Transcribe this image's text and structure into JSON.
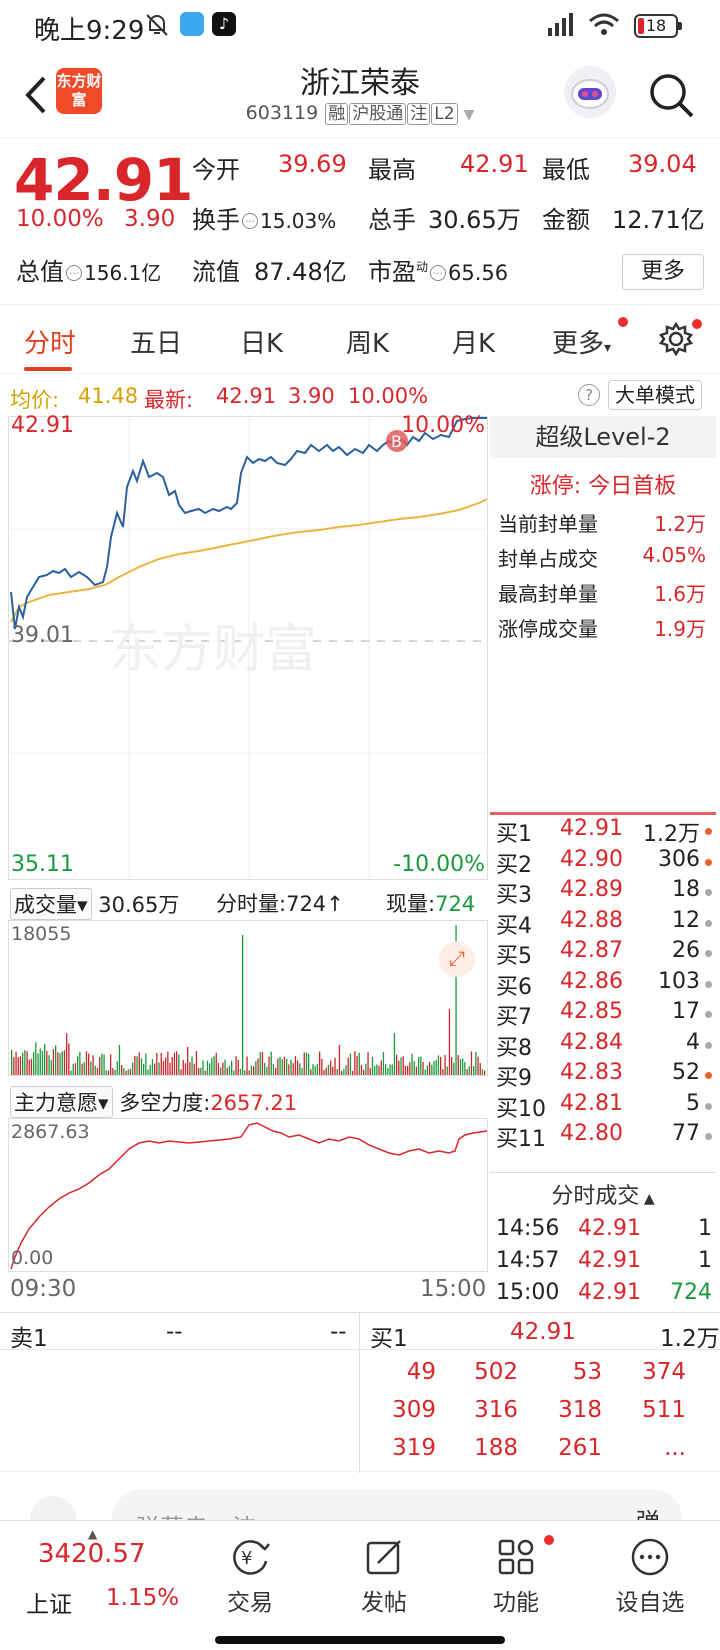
{
  "status": {
    "time": "晚上9:29",
    "battery": "18"
  },
  "header": {
    "logo_text": "东方财富",
    "stock_name": "浙江荣泰",
    "stock_code": "603119",
    "tags": [
      "融",
      "沪股通",
      "注",
      "L2"
    ]
  },
  "quote": {
    "price": "42.91",
    "change_pct": "10.00%",
    "change": "3.90",
    "open_label": "今开",
    "open": "39.69",
    "high_label": "最高",
    "high": "42.91",
    "low_label": "最低",
    "low": "39.04",
    "turnover_label": "换手",
    "turnover": "15.03%",
    "volume_label": "总手",
    "volume": "30.65万",
    "amount_label": "金额",
    "amount": "12.71亿",
    "mcap_label": "总值",
    "mcap": "156.1亿",
    "float_label": "流值",
    "float": "87.48亿",
    "pe_label": "市盈",
    "pe_sup": "动",
    "pe": "65.56",
    "more": "更多"
  },
  "tabs": [
    "分时",
    "五日",
    "日K",
    "周K",
    "月K",
    "更多"
  ],
  "avg_bar": {
    "avg_label": "均价:",
    "avg": "41.48",
    "latest_label": "最新:",
    "latest": "42.91",
    "chg": "3.90",
    "pct": "10.00%",
    "big_order": "大单模式"
  },
  "chart": {
    "top_price": "42.91",
    "top_pct": "10.00%",
    "mid_price": "39.01",
    "bottom_price": "35.11",
    "bottom_pct": "-10.00%",
    "marker": "B",
    "watermark": "东方财富",
    "price_color": "#2b5f9e",
    "avg_color": "#e8b640"
  },
  "volume_panel": {
    "selector": "成交量",
    "total": "30.65万",
    "min_vol_label": "分时量:",
    "min_vol": "724↑",
    "now_label": "现量:",
    "now": "724",
    "max": "18055"
  },
  "mf_panel": {
    "selector": "主力意愿",
    "label": "多空力度:",
    "value": "2657.21",
    "max": "2867.63",
    "min": "0.00",
    "time_start": "09:30",
    "time_end": "15:00"
  },
  "level2": {
    "title": "超级Level-2",
    "status": "涨停: 今日首板",
    "rows": [
      {
        "label": "当前封单量",
        "value": "1.2万"
      },
      {
        "label": "封单占成交",
        "value": "4.05%"
      },
      {
        "label": "最高封单量",
        "value": "1.6万"
      },
      {
        "label": "涨停成交量",
        "value": "1.9万"
      }
    ]
  },
  "order_book": [
    {
      "label": "买1",
      "price": "42.91",
      "qty": "1.2万",
      "dot": "o"
    },
    {
      "label": "买2",
      "price": "42.90",
      "qty": "306",
      "dot": "o"
    },
    {
      "label": "买3",
      "price": "42.89",
      "qty": "18",
      "dot": "g"
    },
    {
      "label": "买4",
      "price": "42.88",
      "qty": "12",
      "dot": "g"
    },
    {
      "label": "买5",
      "price": "42.87",
      "qty": "26",
      "dot": "g"
    },
    {
      "label": "买6",
      "price": "42.86",
      "qty": "103",
      "dot": "g"
    },
    {
      "label": "买7",
      "price": "42.85",
      "qty": "17",
      "dot": "g"
    },
    {
      "label": "买8",
      "price": "42.84",
      "qty": "4",
      "dot": "g"
    },
    {
      "label": "买9",
      "price": "42.83",
      "qty": "52",
      "dot": "o"
    },
    {
      "label": "买10",
      "price": "42.81",
      "qty": "5",
      "dot": "g"
    },
    {
      "label": "买11",
      "price": "42.80",
      "qty": "77",
      "dot": "g"
    }
  ],
  "trades": {
    "title": "分时成交",
    "rows": [
      {
        "time": "14:56",
        "price": "42.91",
        "qty": "1"
      },
      {
        "time": "14:57",
        "price": "42.91",
        "qty": "1"
      },
      {
        "time": "15:00",
        "price": "42.91",
        "qty": "724"
      }
    ]
  },
  "bottom_orders": {
    "sell1_label": "卖1",
    "sell1_price": "--",
    "sell1_qty": "--",
    "buy1_label": "买1",
    "buy1_price": "42.91",
    "buy1_qty": "1.2万",
    "buy_queue": [
      [
        "49",
        "502",
        "53",
        "374"
      ],
      [
        "309",
        "316",
        "318",
        "511"
      ],
      [
        "319",
        "188",
        "261",
        "..."
      ]
    ]
  },
  "comment": {
    "placeholder": "弹幕走一波",
    "btn": "弹"
  },
  "nav": {
    "index_value": "3420.57",
    "index_name": "上证",
    "index_pct": "1.15%",
    "items": [
      "交易",
      "发帖",
      "功能",
      "设自选"
    ]
  }
}
